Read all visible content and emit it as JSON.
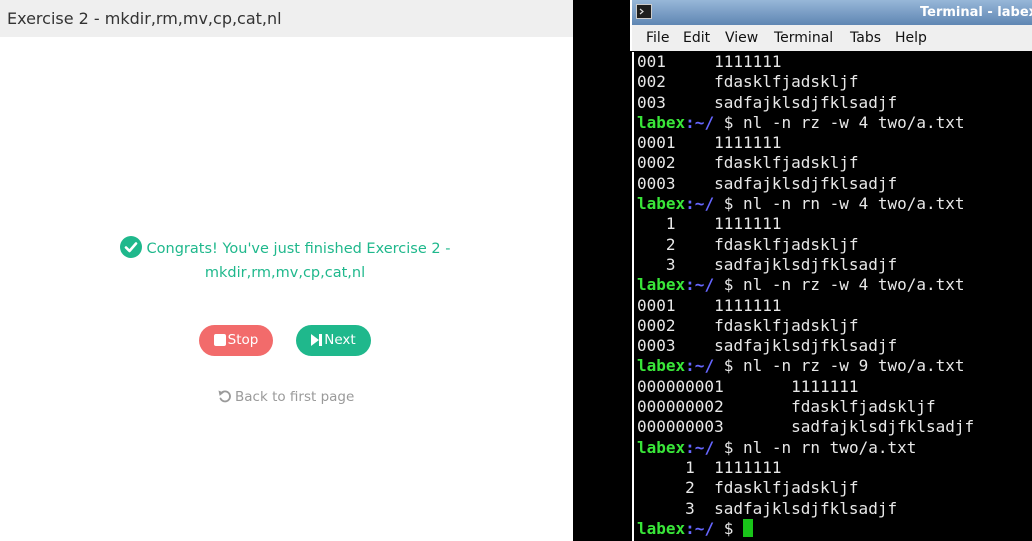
{
  "exercise": {
    "header_title": "Exercise 2 - mkdir,rm,mv,cp,cat,nl",
    "congrats_line1": "Congrats! You've just finished Exercise 2 -",
    "congrats_line2": "mkdir,rm,mv,cp,cat,nl",
    "stop_label": "Stop",
    "next_label": "Next",
    "back_label": "Back to first page",
    "accent_color": "#1fb88c",
    "stop_color": "#f26b6b"
  },
  "terminal": {
    "title": "Terminal - labex",
    "menu": [
      "File",
      "Edit",
      "View",
      "Terminal",
      "Tabs",
      "Help"
    ],
    "lines": [
      {
        "type": "output",
        "text": "001     1111111"
      },
      {
        "type": "output",
        "text": "002     fdasklfjadskljf"
      },
      {
        "type": "output",
        "text": "003     sadfajklsdjfklsadjf"
      },
      {
        "type": "prompt",
        "user": "labex",
        "path": ":~/",
        "cmd": " $ nl -n rz -w 4 two/a.txt"
      },
      {
        "type": "output",
        "text": "0001    1111111"
      },
      {
        "type": "output",
        "text": "0002    fdasklfjadskljf"
      },
      {
        "type": "output",
        "text": "0003    sadfajklsdjfklsadjf"
      },
      {
        "type": "prompt",
        "user": "labex",
        "path": ":~/",
        "cmd": " $ nl -n rn -w 4 two/a.txt"
      },
      {
        "type": "output",
        "text": "   1    1111111"
      },
      {
        "type": "output",
        "text": "   2    fdasklfjadskljf"
      },
      {
        "type": "output",
        "text": "   3    sadfajklsdjfklsadjf"
      },
      {
        "type": "prompt",
        "user": "labex",
        "path": ":~/",
        "cmd": " $ nl -n rz -w 4 two/a.txt"
      },
      {
        "type": "output",
        "text": "0001    1111111"
      },
      {
        "type": "output",
        "text": "0002    fdasklfjadskljf"
      },
      {
        "type": "output",
        "text": "0003    sadfajklsdjfklsadjf"
      },
      {
        "type": "prompt",
        "user": "labex",
        "path": ":~/",
        "cmd": " $ nl -n rz -w 9 two/a.txt"
      },
      {
        "type": "output",
        "text": "000000001       1111111"
      },
      {
        "type": "output",
        "text": "000000002       fdasklfjadskljf"
      },
      {
        "type": "output",
        "text": "000000003       sadfajklsdjfklsadjf"
      },
      {
        "type": "prompt",
        "user": "labex",
        "path": ":~/",
        "cmd": " $ nl -n rn two/a.txt"
      },
      {
        "type": "output",
        "text": "     1  1111111"
      },
      {
        "type": "output",
        "text": "     2  fdasklfjadskljf"
      },
      {
        "type": "output",
        "text": "     3  sadfajklsdjfklsadjf"
      },
      {
        "type": "prompt",
        "user": "labex",
        "path": ":~/",
        "cmd": " $ ",
        "cursor": true
      }
    ]
  }
}
